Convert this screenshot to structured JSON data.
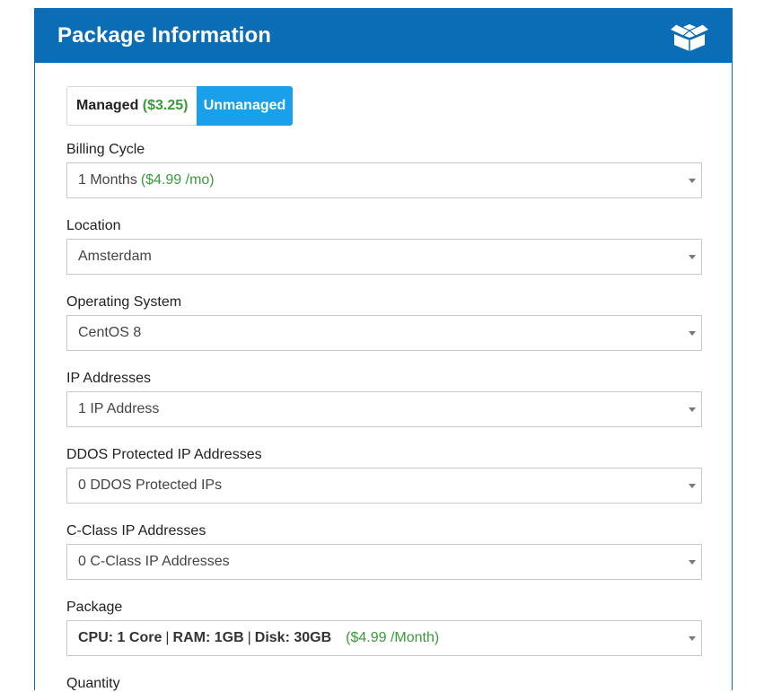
{
  "panel": {
    "title": "Package Information",
    "icon": "open-box-icon",
    "header_color": "#0b6db5"
  },
  "management": {
    "managed_label": "Managed",
    "managed_price": "($3.25)",
    "unmanaged_label": "Unmanaged",
    "selected": "Unmanaged",
    "active_color": "#1aa0ea"
  },
  "fields": {
    "billing_cycle": {
      "label": "Billing Cycle",
      "value": "1 Months",
      "price": "($4.99 /mo)"
    },
    "location": {
      "label": "Location",
      "value": "Amsterdam"
    },
    "operating_system": {
      "label": "Operating System",
      "value": "CentOS 8"
    },
    "ip_addresses": {
      "label": "IP Addresses",
      "value": "1 IP Address"
    },
    "ddos_ips": {
      "label": "DDOS Protected IP Addresses",
      "value": "0 DDOS Protected IPs"
    },
    "c_class_ips": {
      "label": "C-Class IP Addresses",
      "value": "0 C-Class IP Addresses"
    },
    "package": {
      "label": "Package",
      "cpu": "CPU: 1 Core",
      "ram": "RAM: 1GB",
      "disk": "Disk: 30GB",
      "separator": "|",
      "price": "($4.99 /Month)"
    },
    "quantity": {
      "label": "Quantity"
    }
  },
  "colors": {
    "price_green": "#3a9a3a"
  }
}
